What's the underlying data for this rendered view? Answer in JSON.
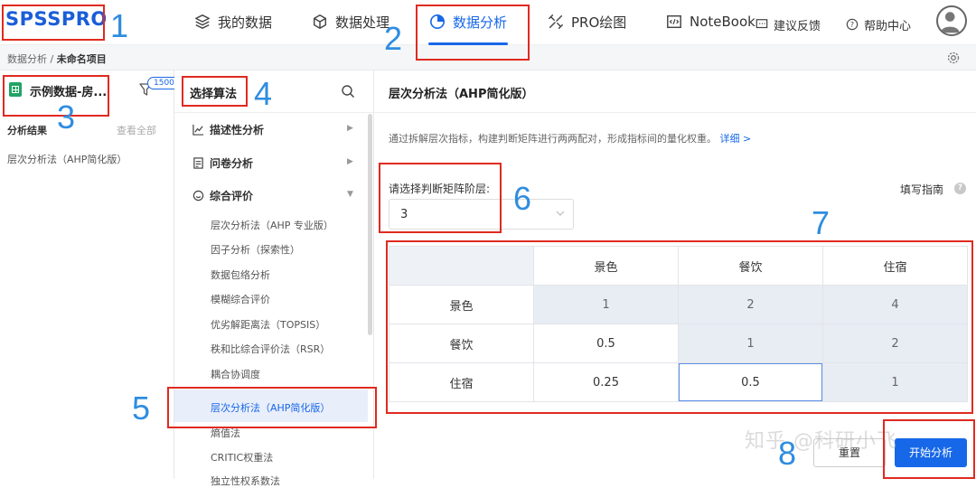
{
  "brand": {
    "logo_text": "SPSSPRO",
    "accent": "#1768e8"
  },
  "nav": {
    "items": [
      {
        "label": "我的数据",
        "icon": "layers-icon"
      },
      {
        "label": "数据处理",
        "icon": "cube-icon"
      },
      {
        "label": "数据分析",
        "icon": "pie-chart-icon",
        "active": true
      },
      {
        "label": "PRO绘图",
        "icon": "palette-icon"
      },
      {
        "label": "NoteBook",
        "icon": "code-icon"
      }
    ],
    "feedback": "建议反馈",
    "help": "帮助中心"
  },
  "breadcrumb": {
    "root": "数据分析",
    "sep": "/",
    "current": "未命名项目"
  },
  "left": {
    "dataset": "示例数据-房...",
    "filter_badge": "1500",
    "results_title": "分析结果",
    "view_all": "查看全部",
    "result_item": "层次分析法（AHP简化版）"
  },
  "algorithms": {
    "title": "选择算法",
    "categories": [
      "描述性分析",
      "问卷分析",
      "综合评价"
    ],
    "items": [
      "层次分析法（AHP 专业版）",
      "因子分析（探索性）",
      "数据包络分析",
      "模糊综合评价",
      "优劣解距离法（TOPSIS）",
      "秩和比综合评价法（RSR）",
      "耦合协调度",
      "层次分析法（AHP简化版）",
      "熵值法",
      "CRITIC权重法",
      "独立性权系数法"
    ],
    "selected": "层次分析法（AHP简化版）"
  },
  "main": {
    "title": "层次分析法（AHP简化版）",
    "description": "通过拆解层次指标，构建判断矩阵进行两两配对，形成指标间的量化权重。",
    "detail_link": "详细 >",
    "level_label": "请选择判断矩阵阶层:",
    "level_value": "3",
    "guide": "填写指南",
    "matrix": {
      "headers": [
        "景色",
        "餐饮",
        "住宿"
      ],
      "rows": [
        {
          "label": "景色",
          "values": [
            "1",
            "2",
            "4"
          ]
        },
        {
          "label": "餐饮",
          "values": [
            "0.5",
            "1",
            "2"
          ]
        },
        {
          "label": "住宿",
          "values": [
            "0.25",
            "0.5",
            "1"
          ]
        }
      ]
    },
    "reset": "重置",
    "start": "开始分析"
  },
  "watermark": "知乎 @科研小飞",
  "annotations": [
    "1",
    "2",
    "3",
    "4",
    "5",
    "6",
    "7",
    "8"
  ],
  "annotation_color": "#e02a20",
  "number_color": "#2f8de0"
}
